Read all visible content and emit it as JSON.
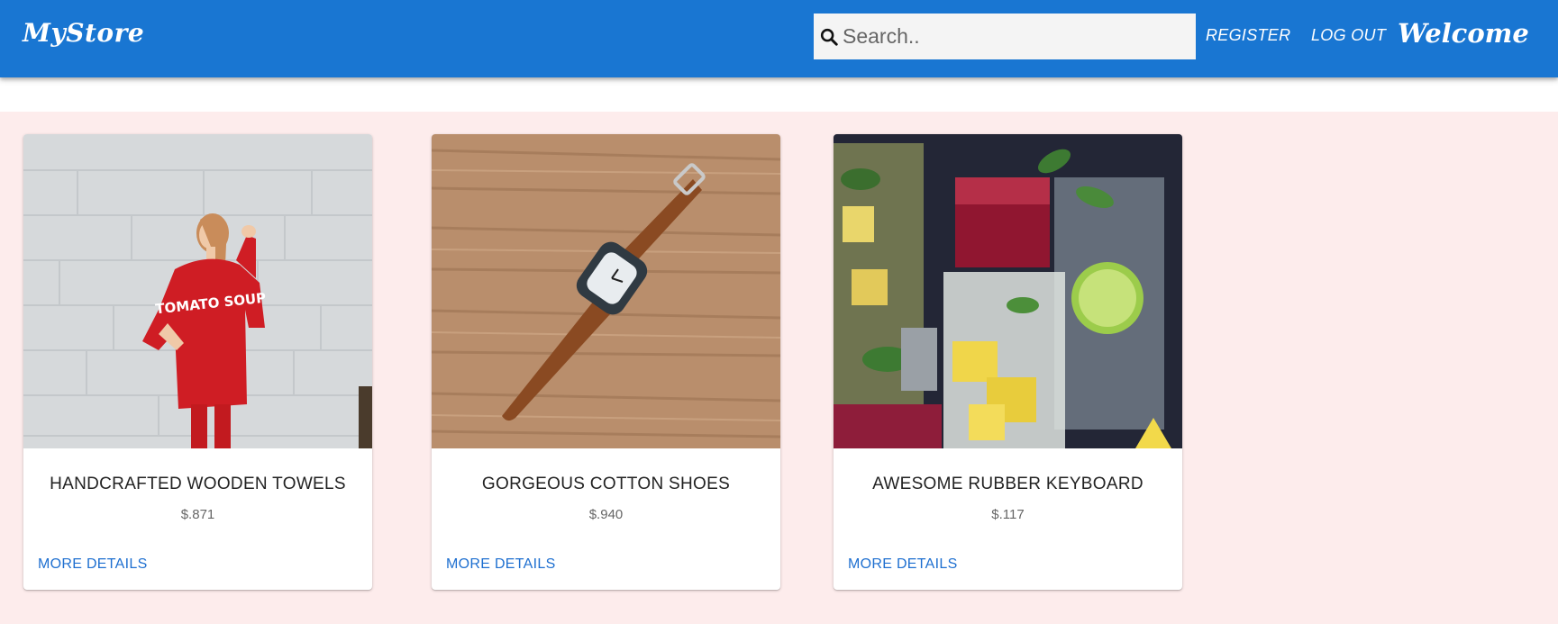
{
  "header": {
    "brand": "MyStore",
    "search": {
      "placeholder": "Search..",
      "value": ""
    },
    "nav": {
      "register": "REGISTER",
      "logout": "LOG OUT"
    },
    "welcome": "Welcome"
  },
  "products": [
    {
      "title": "HANDCRAFTED WOODEN TOWELS",
      "price": "$.871",
      "action": "MORE DETAILS",
      "image": "woman-in-red-sweater-photo",
      "sweater_text": "TOMATO SOUP"
    },
    {
      "title": "GORGEOUS COTTON SHOES",
      "price": "$.940",
      "action": "MORE DETAILS",
      "image": "watch-on-wood-photo"
    },
    {
      "title": "AWESOME RUBBER KEYBOARD",
      "price": "$.117",
      "action": "MORE DETAILS",
      "image": "cocktail-glasses-photo"
    }
  ],
  "colors": {
    "appbar": "#1976d2",
    "content_background": "#fdecec",
    "link": "#1e6fd0"
  }
}
